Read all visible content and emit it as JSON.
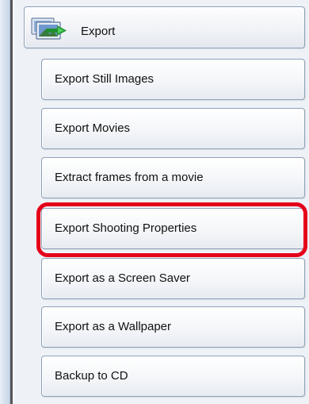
{
  "header": {
    "label": "Export",
    "icon": "export-images-icon"
  },
  "menu": {
    "items": [
      {
        "label": "Export Still Images"
      },
      {
        "label": "Export Movies"
      },
      {
        "label": "Extract frames from a movie"
      },
      {
        "label": "Export Shooting Properties"
      },
      {
        "label": "Export as a Screen Saver"
      },
      {
        "label": "Export as a Wallpaper"
      },
      {
        "label": "Backup to CD"
      }
    ]
  },
  "highlight": {
    "target_index": 3,
    "color": "#e5001a"
  }
}
